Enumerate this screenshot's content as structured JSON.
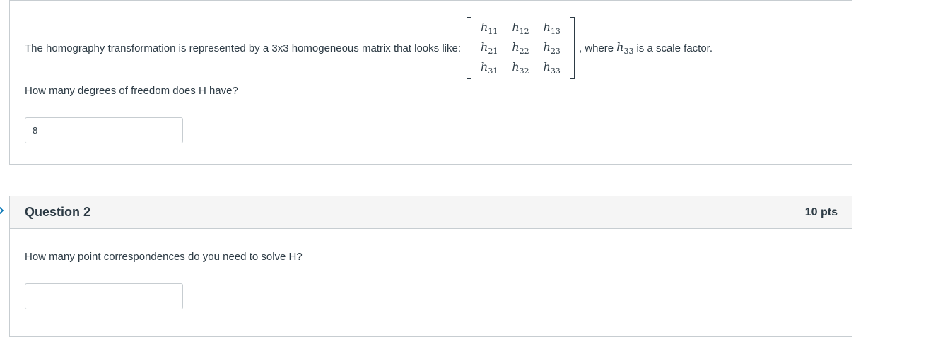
{
  "question1": {
    "stem_before": "The homography transformation is represented by a 3x3 homogeneous matrix that looks like:",
    "matrix": [
      [
        {
          "var": "h",
          "sub": "11"
        },
        {
          "var": "h",
          "sub": "12"
        },
        {
          "var": "h",
          "sub": "13"
        }
      ],
      [
        {
          "var": "h",
          "sub": "21"
        },
        {
          "var": "h",
          "sub": "22"
        },
        {
          "var": "h",
          "sub": "23"
        }
      ],
      [
        {
          "var": "h",
          "sub": "31"
        },
        {
          "var": "h",
          "sub": "32"
        },
        {
          "var": "h",
          "sub": "33"
        }
      ]
    ],
    "stem_after_prefix": ", where",
    "scale_var": {
      "var": "h",
      "sub": "33"
    },
    "stem_after_suffix": "is a scale factor.",
    "prompt": "How many degrees of freedom does H have?",
    "answer_value": "8"
  },
  "question2": {
    "title": "Question 2",
    "points": "10 pts",
    "prompt": "How many point correspondences do you need to solve H?",
    "answer_value": ""
  },
  "colors": {
    "text": "#2d3b45",
    "border": "#c7cdd1",
    "header_bg": "#f5f5f5",
    "accent": "#0374b5"
  },
  "icons": {
    "nav_arrow": "chevron-right-icon"
  }
}
